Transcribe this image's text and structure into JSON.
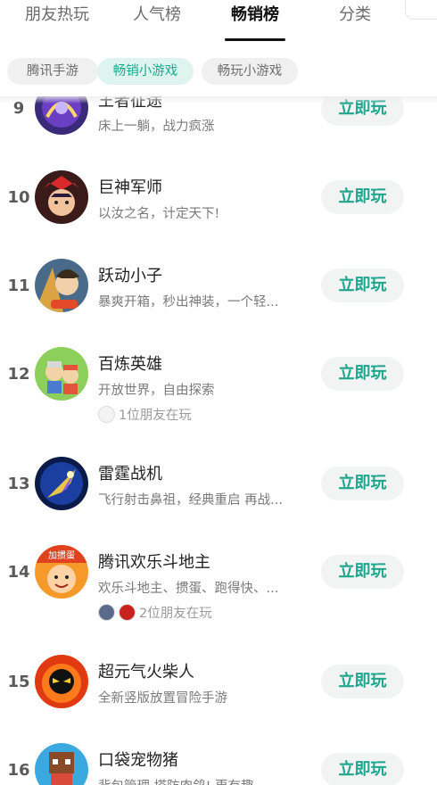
{
  "top_tabs": [
    "朋友热玩",
    "人气榜",
    "畅销榜",
    "分类"
  ],
  "active_tab": "畅销榜",
  "chips": [
    "腾讯手游",
    "畅销小游戏",
    "畅玩小游戏"
  ],
  "active_chip": "畅销小游戏",
  "play_label": "立即玩",
  "games": [
    {
      "rank": "9",
      "title": "王者征途",
      "desc": "床上一躺，战力疯涨",
      "friends": null
    },
    {
      "rank": "10",
      "title": "巨神军师",
      "desc": "以汝之名，计定天下!",
      "friends": null
    },
    {
      "rank": "11",
      "title": "跃动小子",
      "desc": "暴爽开箱，秒出神装，一个轻...",
      "friends": null
    },
    {
      "rank": "12",
      "title": "百炼英雄",
      "desc": "开放世界，自由探索",
      "friends": "1位朋友在玩"
    },
    {
      "rank": "13",
      "title": "雷霆战机",
      "desc": "飞行射击鼻祖，经典重启 再战...",
      "friends": null
    },
    {
      "rank": "14",
      "title": "腾讯欢乐斗地主",
      "desc": "欢乐斗地主、掼蛋、跑得快、...",
      "friends": "2位朋友在玩",
      "badge": "加掼蛋"
    },
    {
      "rank": "15",
      "title": "超元气火柴人",
      "desc": "全新竖版放置冒险手游",
      "friends": null
    },
    {
      "rank": "16",
      "title": "口袋宠物猪",
      "desc": "背包管理 塔防肉鸽! 更有趣",
      "friends": null
    }
  ],
  "colors": {
    "accent": "#1fa58d",
    "chip_active_bg": "#e0f4ef",
    "button_bg": "#f2f3f3"
  }
}
